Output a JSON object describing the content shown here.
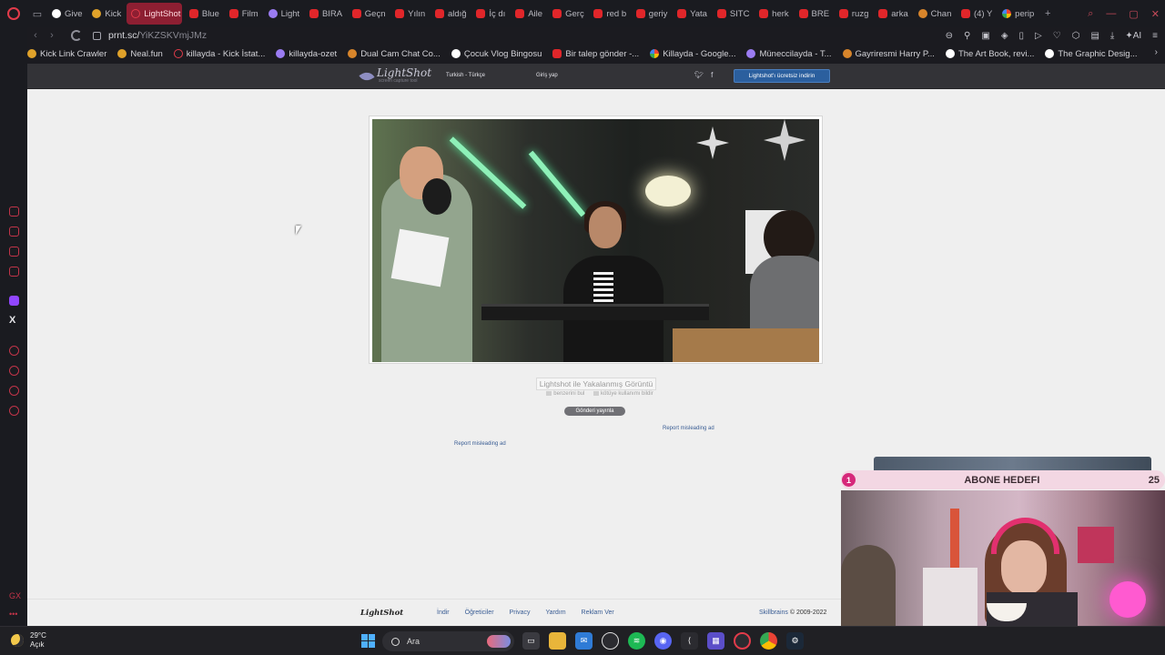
{
  "browser": {
    "tabs": [
      {
        "label": "Give",
        "icon": "giveaway-icon"
      },
      {
        "label": "Kick",
        "icon": "kick-icon"
      },
      {
        "label": "LightShot",
        "icon": "lightshot-icon",
        "active": true
      },
      {
        "label": "Blue",
        "icon": "youtube-icon"
      },
      {
        "label": "Film",
        "icon": "youtube-icon"
      },
      {
        "label": "Light",
        "icon": "lightshot-feather-icon"
      },
      {
        "label": "BIRA",
        "icon": "youtube-icon"
      },
      {
        "label": "Geçn",
        "icon": "youtube-icon"
      },
      {
        "label": "Yılın",
        "icon": "youtube-icon"
      },
      {
        "label": "aldığ",
        "icon": "youtube-icon"
      },
      {
        "label": "İç dı",
        "icon": "youtube-icon"
      },
      {
        "label": "Aile",
        "icon": "youtube-icon"
      },
      {
        "label": "Gerç",
        "icon": "youtube-icon"
      },
      {
        "label": "red b",
        "icon": "youtube-icon"
      },
      {
        "label": "geriy",
        "icon": "youtube-icon"
      },
      {
        "label": "Yata",
        "icon": "youtube-icon"
      },
      {
        "label": "SITC",
        "icon": "youtube-icon"
      },
      {
        "label": "herk",
        "icon": "youtube-icon"
      },
      {
        "label": "BRE",
        "icon": "youtube-icon"
      },
      {
        "label": "ruzg",
        "icon": "youtube-icon"
      },
      {
        "label": "arka",
        "icon": "youtube-icon"
      },
      {
        "label": "Chan",
        "icon": "channel-icon"
      },
      {
        "label": "(4) Y",
        "icon": "youtube-icon"
      },
      {
        "label": "perip",
        "icon": "google-icon"
      }
    ],
    "url": "prnt.sc/",
    "url_path": "YiKZSKVmjJMz",
    "bookmarks": [
      {
        "label": "Kick Link Crawler",
        "icon": "kick"
      },
      {
        "label": "Neal.fun",
        "icon": "kick"
      },
      {
        "label": "killayda - Kick İstat...",
        "icon": "ls"
      },
      {
        "label": "killayda-ozet",
        "icon": "light"
      },
      {
        "label": "Dual Cam Chat Co...",
        "icon": "ch"
      },
      {
        "label": "Çocuk Vlog Bingosu",
        "icon": "give"
      },
      {
        "label": "Bir talep gönder -...",
        "icon": "yt"
      },
      {
        "label": "Killayda - Google...",
        "icon": "g"
      },
      {
        "label": "Müneccilayda - T...",
        "icon": "light"
      },
      {
        "label": "Gayriresmi Harry P...",
        "icon": "ch"
      },
      {
        "label": "The Art Book, revi...",
        "icon": "give"
      },
      {
        "label": "The Graphic Desig...",
        "icon": "give"
      }
    ]
  },
  "lightshot": {
    "logo": "LightShot",
    "logo_sub": "screen capture tool",
    "language": "Turkish - Türkçe",
    "login": "Giriş yap",
    "download": "Lightshot'ı ücretsiz indirin",
    "caption": "Lightshot ile Yakalanmış Görüntü",
    "similar": "benzerini bul",
    "report_abuse": "kötüye kullanımı bildir",
    "publish": "Gönderi yayınla",
    "report_ad_1": "Report misleading ad",
    "report_ad_2": "Report misleading ad",
    "footer": {
      "logo": "LightShot",
      "links": [
        "İndir",
        "Öğreticiler",
        "Privacy",
        "Yardım",
        "Reklam Ver"
      ],
      "company": "Skillbrains",
      "copyright": "© 2009-2022"
    }
  },
  "overlay": {
    "goal_current": "1",
    "goal_title": "ABONE HEDEFI",
    "goal_target": "25"
  },
  "taskbar": {
    "temp": "29°C",
    "weather": "Açık",
    "search": "Ara",
    "colors": {
      "accent": "#4fb0ff"
    }
  },
  "colors": {
    "browser_accent": "#e23b4a",
    "active_tab": "#8d1f32",
    "goal_pill": "#d6287a"
  }
}
